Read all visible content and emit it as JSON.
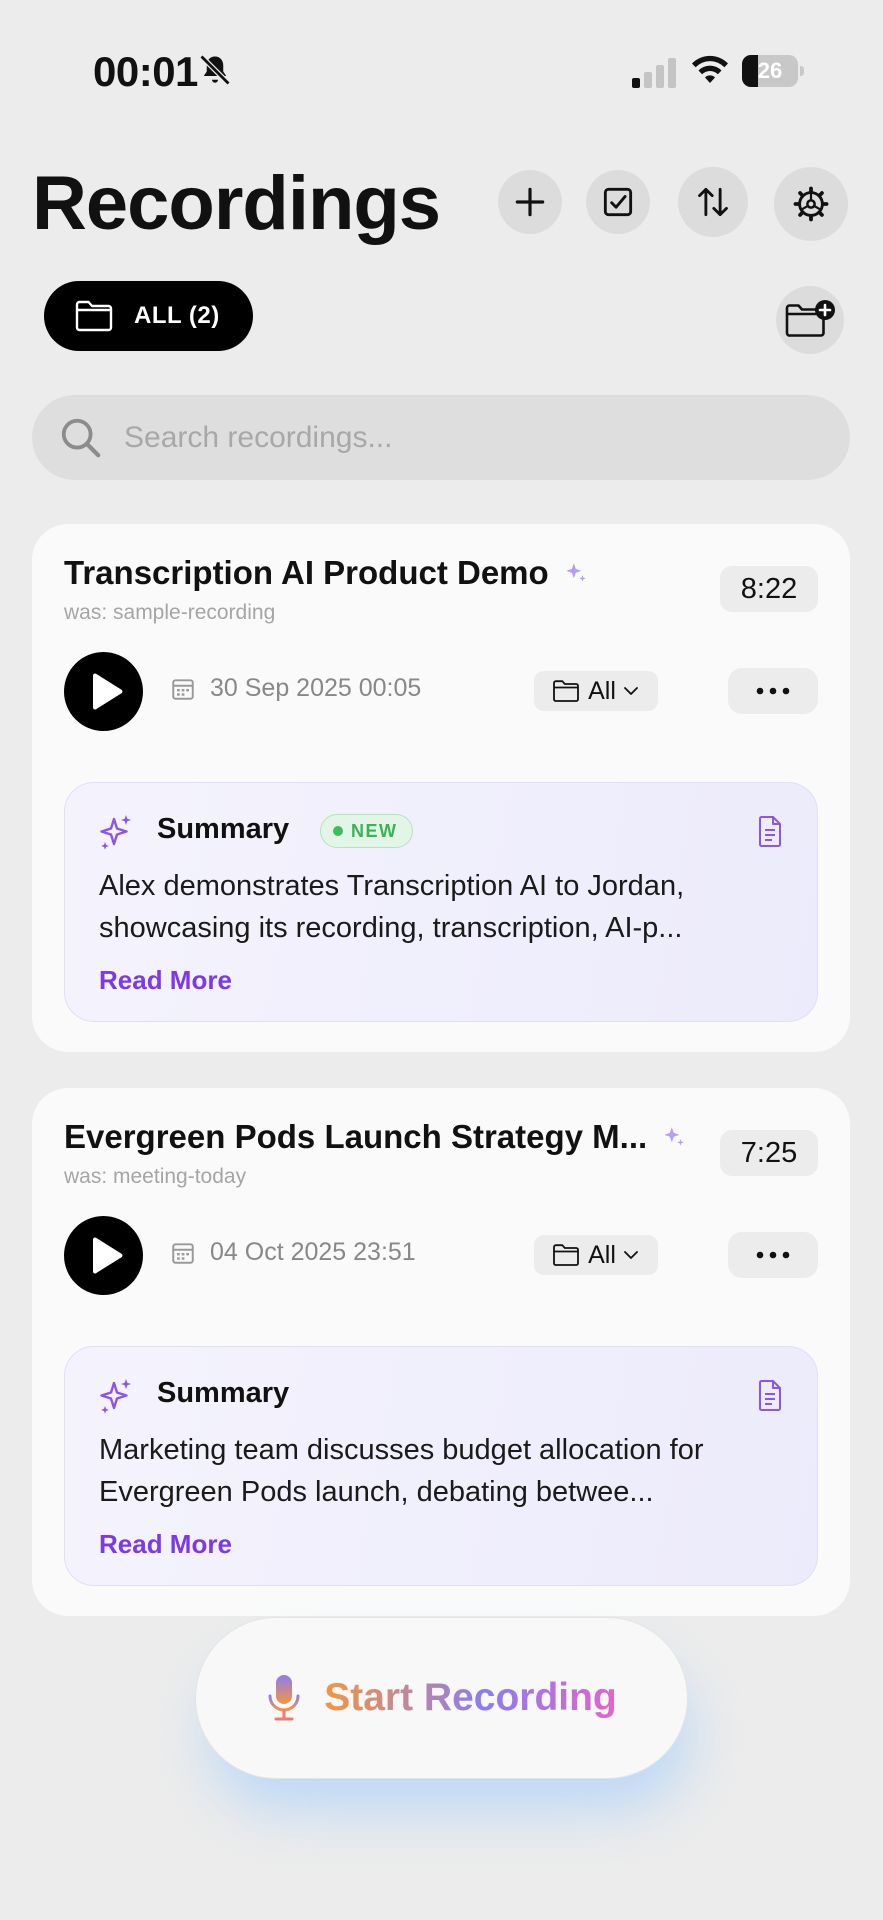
{
  "status_bar": {
    "time": "00:01",
    "battery": "26"
  },
  "header": {
    "title": "Recordings"
  },
  "filter": {
    "label": "ALL (2)"
  },
  "search": {
    "placeholder": "Search recordings..."
  },
  "recordings": [
    {
      "title": "Transcription AI Product Demo",
      "original_name": "was: sample-recording",
      "duration": "8:22",
      "date": "30 Sep 2025 00:05",
      "folder": "All",
      "summary": {
        "title": "Summary",
        "badge": "NEW",
        "text": "Alex demonstrates Transcription AI to Jordan, showcasing its recording, transcription, AI-p...",
        "read_more": "Read More"
      }
    },
    {
      "title": "Evergreen Pods Launch Strategy M...",
      "original_name": "was: meeting-today",
      "duration": "7:25",
      "date": "04 Oct 2025 23:51",
      "folder": "All",
      "summary": {
        "title": "Summary",
        "text": "Marketing team discusses budget allocation for Evergreen Pods launch, debating betwee...",
        "read_more": "Read More"
      }
    }
  ],
  "record_button": {
    "label": "Start Recording"
  },
  "colors": {
    "accent": "#7c3ae6",
    "new_badge": "#38b455",
    "primary": "#000000"
  }
}
